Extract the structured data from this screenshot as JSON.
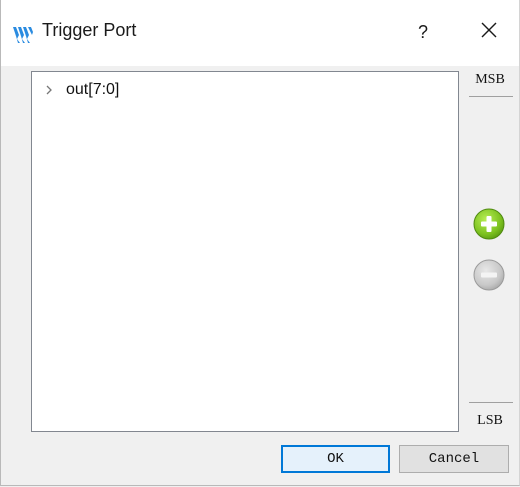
{
  "window": {
    "title": "Trigger Port",
    "help_label": "?",
    "close_icon": "close-icon",
    "app_icon": "gowin-logo-icon"
  },
  "tree": {
    "items": [
      {
        "label": "out[7:0]",
        "expanded": false,
        "icon": "chevron-right-icon"
      }
    ]
  },
  "side_panel": {
    "msb_label": "MSB",
    "lsb_label": "LSB",
    "add_icon": "plus-circle-icon",
    "remove_icon": "minus-circle-icon",
    "add_color": "#7cc11f",
    "remove_color": "#c8c8c8"
  },
  "buttons": {
    "ok_label": "OK",
    "cancel_label": "Cancel"
  },
  "colors": {
    "accent": "#0078d7",
    "logo": "#2a8be0"
  }
}
